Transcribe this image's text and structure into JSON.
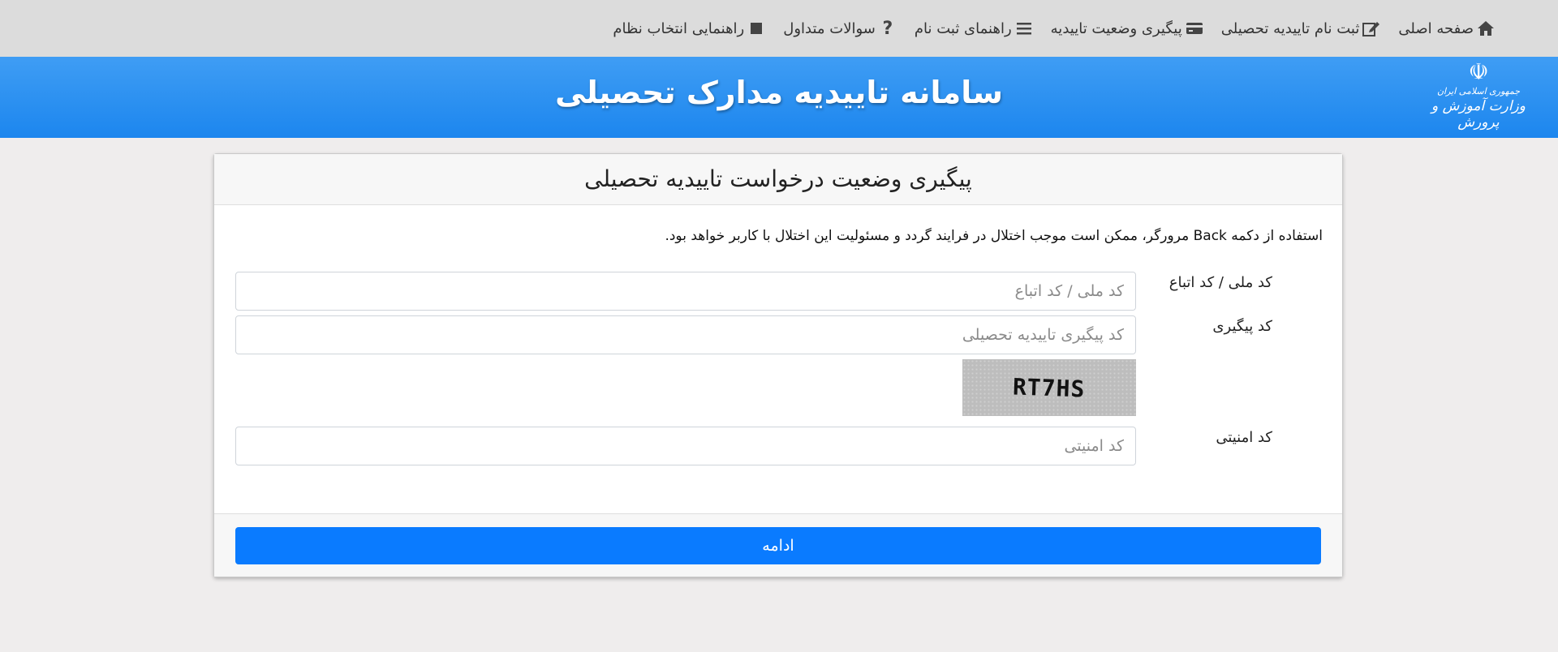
{
  "nav": {
    "items": [
      {
        "label": "صفحه اصلی",
        "icon": "home-icon"
      },
      {
        "label": "ثبت نام تاییدیه تحصیلی",
        "icon": "edit-icon"
      },
      {
        "label": "پیگیری وضعیت تاییدیه",
        "icon": "card-icon"
      },
      {
        "label": "راهنمای ثبت نام",
        "icon": "menu-icon"
      },
      {
        "label": "سوالات متداول",
        "icon": "question-icon"
      },
      {
        "label": "راهنمایی انتخاب نظام",
        "icon": "square-icon"
      }
    ]
  },
  "banner": {
    "title": "سامانه تاییدیه مدارک تحصیلی",
    "logo_line1": "جمهوری اسلامی ایران",
    "logo_line2": "وزارت آموزش و پرورش",
    "emblem": "☫"
  },
  "card": {
    "header": "پیگیری وضعیت درخواست تاییدیه تحصیلی",
    "warning": "استفاده از دکمه Back مرورگر، ممکن است موجب اختلال در فرایند گردد و مسئولیت این اختلال با کاربر خواهد بود.",
    "fields": {
      "national_code_label": "کد ملی / کد اتباع",
      "national_code_placeholder": "کد ملی / کد اتباع",
      "tracking_label": "کد پیگیری",
      "tracking_placeholder": "کد پیگیری تاییدیه تحصیلی",
      "security_label": "کد امنیتی",
      "security_placeholder": "کد امنیتی"
    },
    "captcha_text": "RT7HS",
    "submit_label": "ادامه"
  },
  "colors": {
    "banner": "#1c86ee",
    "button": "#0a7bff",
    "nav_bg": "#dcdcdc"
  }
}
